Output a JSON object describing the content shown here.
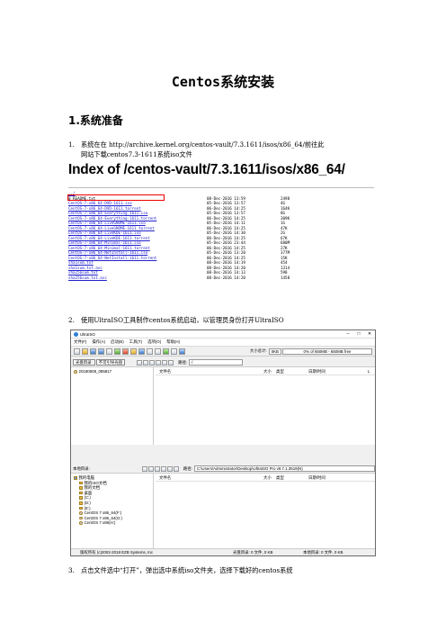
{
  "doc": {
    "title": "Centos系统安装",
    "heading": "1.系统准备",
    "steps": [
      {
        "num": "1.",
        "line1": "系统在在 http://archive.kernel.org/centos-vault/7.3.1611/isos/x86_64/前往此",
        "line2": "网站下载centos7.3-1611系统iso文件"
      },
      {
        "num": "2.",
        "line1": "使用UltraISO工具制作centos系统启动，以管理员身份打开UltraISO"
      },
      {
        "num": "3.",
        "line1": "点击文件选中“打开”，弹出选中系统iso文件夹，选择下载好的centos系统"
      }
    ]
  },
  "index": {
    "heading": "Index of /centos-vault/7.3.1611/isos/x86_64/",
    "parent": "../",
    "files": [
      {
        "name": "0_README.txt",
        "date": "08-Dec-2016 13:59",
        "size": "2498",
        "link": false
      },
      {
        "name": "CentOS-7-x86_64-DVD-1611.iso",
        "date": "05-Dec-2016 13:57",
        "size": "4G",
        "link": true
      },
      {
        "name": "CentOS-7-x86_64-DVD-1611.torrent",
        "date": "06-Dec-2016 14:25",
        "size": "164K",
        "link": true
      },
      {
        "name": "CentOS-7-x86_64-Everything-1611.iso",
        "date": "05-Dec-2016 13:57",
        "size": "8G",
        "link": true
      },
      {
        "name": "CentOS-7-x86_64-Everything-1611.torrent",
        "date": "06-Dec-2016 14:25",
        "size": "309K",
        "link": true
      },
      {
        "name": "CentOS-7-x86_64-LiveGNOME-1611.iso",
        "date": "05-Dec-2016 14:11",
        "size": "1G",
        "link": true
      },
      {
        "name": "CentOS-7-x86_64-LiveGNOME-1611.torrent",
        "date": "06-Dec-2016 14:25",
        "size": "47K",
        "link": true
      },
      {
        "name": "CentOS-7-x86_64-LiveKDE-1611.iso",
        "date": "05-Dec-2016 14:30",
        "size": "2G",
        "link": true
      },
      {
        "name": "CentOS-7-x86_64-LiveKDE-1611.torrent",
        "date": "06-Dec-2016 14:25",
        "size": "67K",
        "link": true
      },
      {
        "name": "CentOS-7-x86_64-Minimal-1611.iso",
        "date": "05-Dec-2016 23:44",
        "size": "680M",
        "link": true
      },
      {
        "name": "CentOS-7-x86_64-Minimal-1611.torrent",
        "date": "06-Dec-2016 14:25",
        "size": "27K",
        "link": true
      },
      {
        "name": "CentOS-7-x86_64-NetInstall-1611.iso",
        "date": "05-Dec-2016 13:20",
        "size": "377M",
        "link": true
      },
      {
        "name": "CentOS-7-x86_64-NetInstall-1611.torrent",
        "date": "06-Dec-2016 14:25",
        "size": "15K",
        "link": true
      },
      {
        "name": "sha1sum.txt",
        "date": "08-Dec-2016 14:19",
        "size": "454",
        "link": true
      },
      {
        "name": "sha1sum.txt.asc",
        "date": "08-Dec-2016 14:20",
        "size": "1314",
        "link": true
      },
      {
        "name": "sha256sum.txt",
        "date": "08-Dec-2016 14:13",
        "size": "598",
        "link": true
      },
      {
        "name": "sha256sum.txt.asc",
        "date": "08-Dec-2016 14:20",
        "size": "1458",
        "link": true
      }
    ]
  },
  "ultraiso": {
    "title": "UltraISO",
    "menu": [
      "文件(F)",
      "操作(A)",
      "启动(B)",
      "工具(T)",
      "选项(O)",
      "帮助(H)"
    ],
    "size_label": "大小总计:",
    "size_value": "0KB",
    "size_bar": "0% of 650MB - 650MB free",
    "cd_tab": "光盘目录:",
    "cd_tab2": "不可引导光盘",
    "path_label": "路径:",
    "cd_path": "/",
    "cd_item": "20180508_085817",
    "cols": {
      "name": "文件名",
      "size": "大小",
      "type": "类型",
      "date": "日期/时间",
      "lba": "L"
    },
    "local_label": "本地目录:",
    "local_path": "C:\\Users\\Administrator\\Desktop\\UltraISO Pro v9.7.1.3519(N)",
    "tree": [
      "我的电脑",
      "我的ISO文档",
      "我的文档",
      "桌面",
      "(C:)",
      "(D:)",
      "(E:)",
      "CentOS 7 x86_64(F:)",
      "CentOS 7 x86_64(G:)",
      "CentOS 7 x86(H:)"
    ],
    "status": {
      "copyright": "版权所有 (c)2002-2018 EZB Systems, Inc",
      "cd_dir": "光盘目录: 0 文件, 0 KB",
      "local_dir": "本地目录: 0 文件, 0 KB"
    }
  }
}
